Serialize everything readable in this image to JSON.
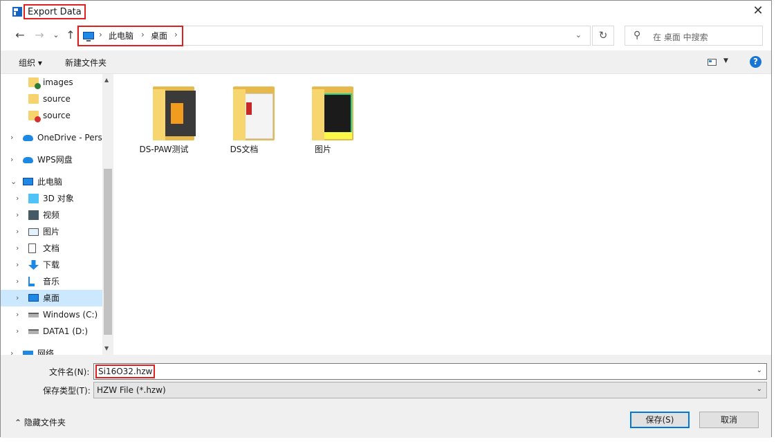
{
  "window": {
    "title": "Export Data",
    "close_glyph": "✕"
  },
  "nav": {
    "back_glyph": "←",
    "forward_glyph": "→",
    "recent_glyph": "⌄",
    "up_glyph": "↑",
    "breadcrumbs": [
      "此电脑",
      "桌面"
    ],
    "separator": "›",
    "dropdown_glyph": "⌄",
    "refresh_glyph": "↻",
    "search_glyph": "⚲",
    "search_placeholder": "在 桌面 中搜索"
  },
  "toolbar": {
    "organize": "组织 ▾",
    "new_folder": "新建文件夹",
    "view_caret": "▼",
    "help": "?"
  },
  "tree": [
    {
      "label": "images",
      "chev": "",
      "icon": "folder-check-icon",
      "indent": 1
    },
    {
      "label": "source",
      "chev": "",
      "icon": "folder-icon",
      "indent": 1
    },
    {
      "label": "source",
      "chev": "",
      "icon": "folder-warning-icon",
      "indent": 1
    },
    {
      "label": "OneDrive - Perso",
      "chev": "›",
      "icon": "onedrive-icon",
      "indent": 0
    },
    {
      "label": "WPS网盘",
      "chev": "›",
      "icon": "wps-cloud-icon",
      "indent": 0
    },
    {
      "label": "此电脑",
      "chev": "⌄",
      "icon": "this-pc-icon",
      "indent": 0
    },
    {
      "label": "3D 对象",
      "chev": "›",
      "icon": "3d-objects-icon",
      "indent": 1
    },
    {
      "label": "视频",
      "chev": "›",
      "icon": "videos-icon",
      "indent": 1
    },
    {
      "label": "图片",
      "chev": "›",
      "icon": "pictures-icon",
      "indent": 1
    },
    {
      "label": "文档",
      "chev": "›",
      "icon": "documents-icon",
      "indent": 1
    },
    {
      "label": "下载",
      "chev": "›",
      "icon": "downloads-icon",
      "indent": 1
    },
    {
      "label": "音乐",
      "chev": "›",
      "icon": "music-icon",
      "indent": 1
    },
    {
      "label": "桌面",
      "chev": "›",
      "icon": "desktop-icon",
      "indent": 1,
      "selected": true
    },
    {
      "label": "Windows (C:)",
      "chev": "›",
      "icon": "drive-c-icon",
      "indent": 1
    },
    {
      "label": "DATA1 (D:)",
      "chev": "›",
      "icon": "drive-d-icon",
      "indent": 1
    },
    {
      "label": "网络",
      "chev": "›",
      "icon": "network-icon",
      "indent": 0
    }
  ],
  "scroll": {
    "up": "▲",
    "down": "▼"
  },
  "files": [
    {
      "name": "DS-PAW测试",
      "icon": "folder-ds-paw-icon"
    },
    {
      "name": "DS文档",
      "icon": "folder-documents-icon"
    },
    {
      "name": "图片",
      "icon": "folder-pictures-icon"
    }
  ],
  "bottom": {
    "filename_label": "文件名(N):",
    "filename_value": "Si16O32.hzw",
    "filetype_label": "保存类型(T):",
    "filetype_value": "HZW File (*.hzw)",
    "dropdown_glyph": "⌄",
    "hide_folders": "⌃ 隐藏文件夹",
    "save_button": "保存(S)",
    "cancel_button": "取消"
  },
  "colors": {
    "highlight": "#e02020",
    "accent": "#0078d7",
    "folder": "#f6d36f",
    "selected": "#cce8ff"
  }
}
